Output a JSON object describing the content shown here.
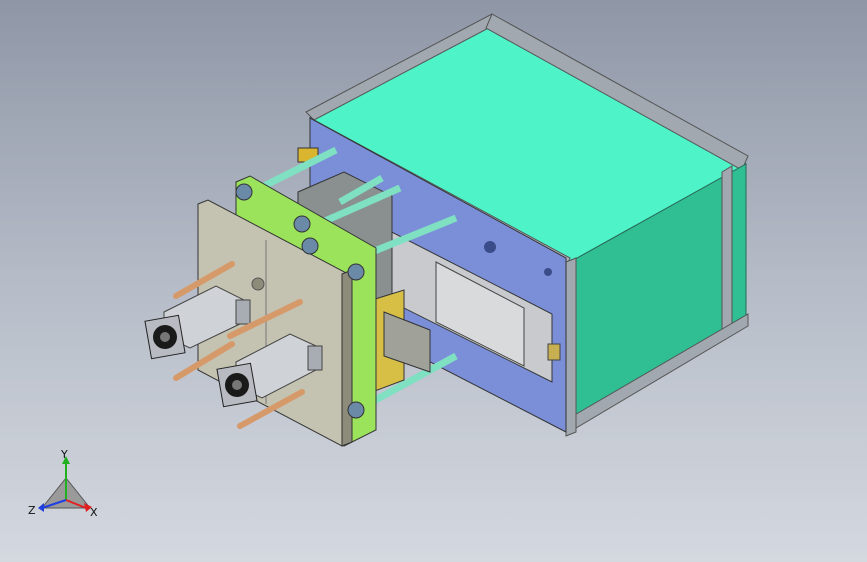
{
  "viewport": {
    "background_top": "#8f97a7",
    "background_bottom": "#d4d8df"
  },
  "model": {
    "colors": {
      "frame": "#9aa0a8",
      "top_panel": "#4ef3c8",
      "side_panel": "#2fbf93",
      "back_plate": "#7b8fd8",
      "green_plate": "#9be35a",
      "front_plate": "#c4c2b0",
      "rod": "#7fe0c2",
      "copper_rod": "#d69a6a",
      "cylinder": "#cfd2d6",
      "motor": "#b8bcc2",
      "bracket": "#d7bf46"
    }
  },
  "triad": {
    "y_label": "Y",
    "x_label": "X",
    "z_label": "Z",
    "x_color": "#e02020",
    "y_color": "#20b020",
    "z_color": "#2040e0"
  }
}
